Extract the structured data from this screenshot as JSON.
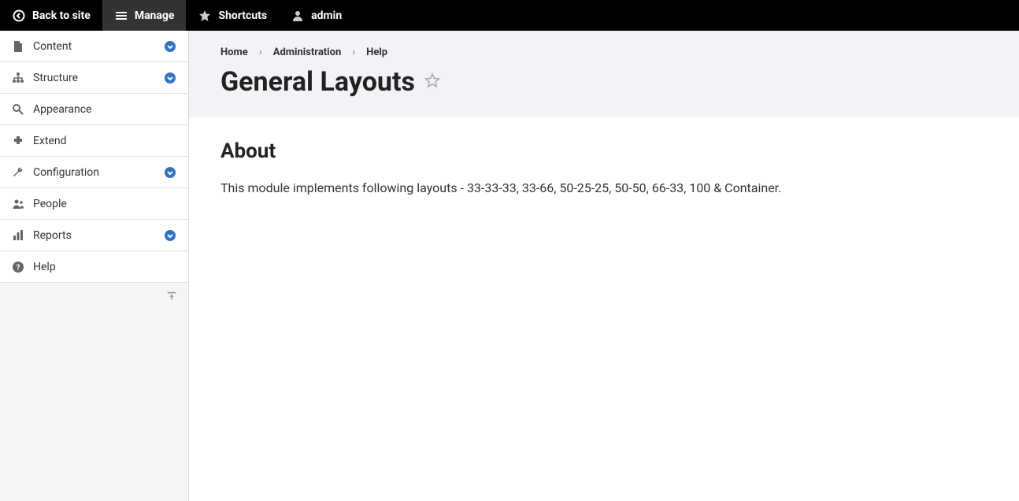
{
  "toolbar": {
    "back_to_site": "Back to site",
    "manage": "Manage",
    "shortcuts": "Shortcuts",
    "user": "admin"
  },
  "sidebar": {
    "items": [
      {
        "label": "Content",
        "expandable": true
      },
      {
        "label": "Structure",
        "expandable": true
      },
      {
        "label": "Appearance",
        "expandable": false
      },
      {
        "label": "Extend",
        "expandable": false
      },
      {
        "label": "Configuration",
        "expandable": true
      },
      {
        "label": "People",
        "expandable": false
      },
      {
        "label": "Reports",
        "expandable": true
      },
      {
        "label": "Help",
        "expandable": false
      }
    ]
  },
  "breadcrumb": {
    "items": [
      "Home",
      "Administration",
      "Help"
    ]
  },
  "page": {
    "title": "General Layouts",
    "about_heading": "About",
    "about_text": "This module implements following layouts - 33-33-33, 33-66, 50-25-25, 50-50, 66-33, 100 & Container."
  }
}
